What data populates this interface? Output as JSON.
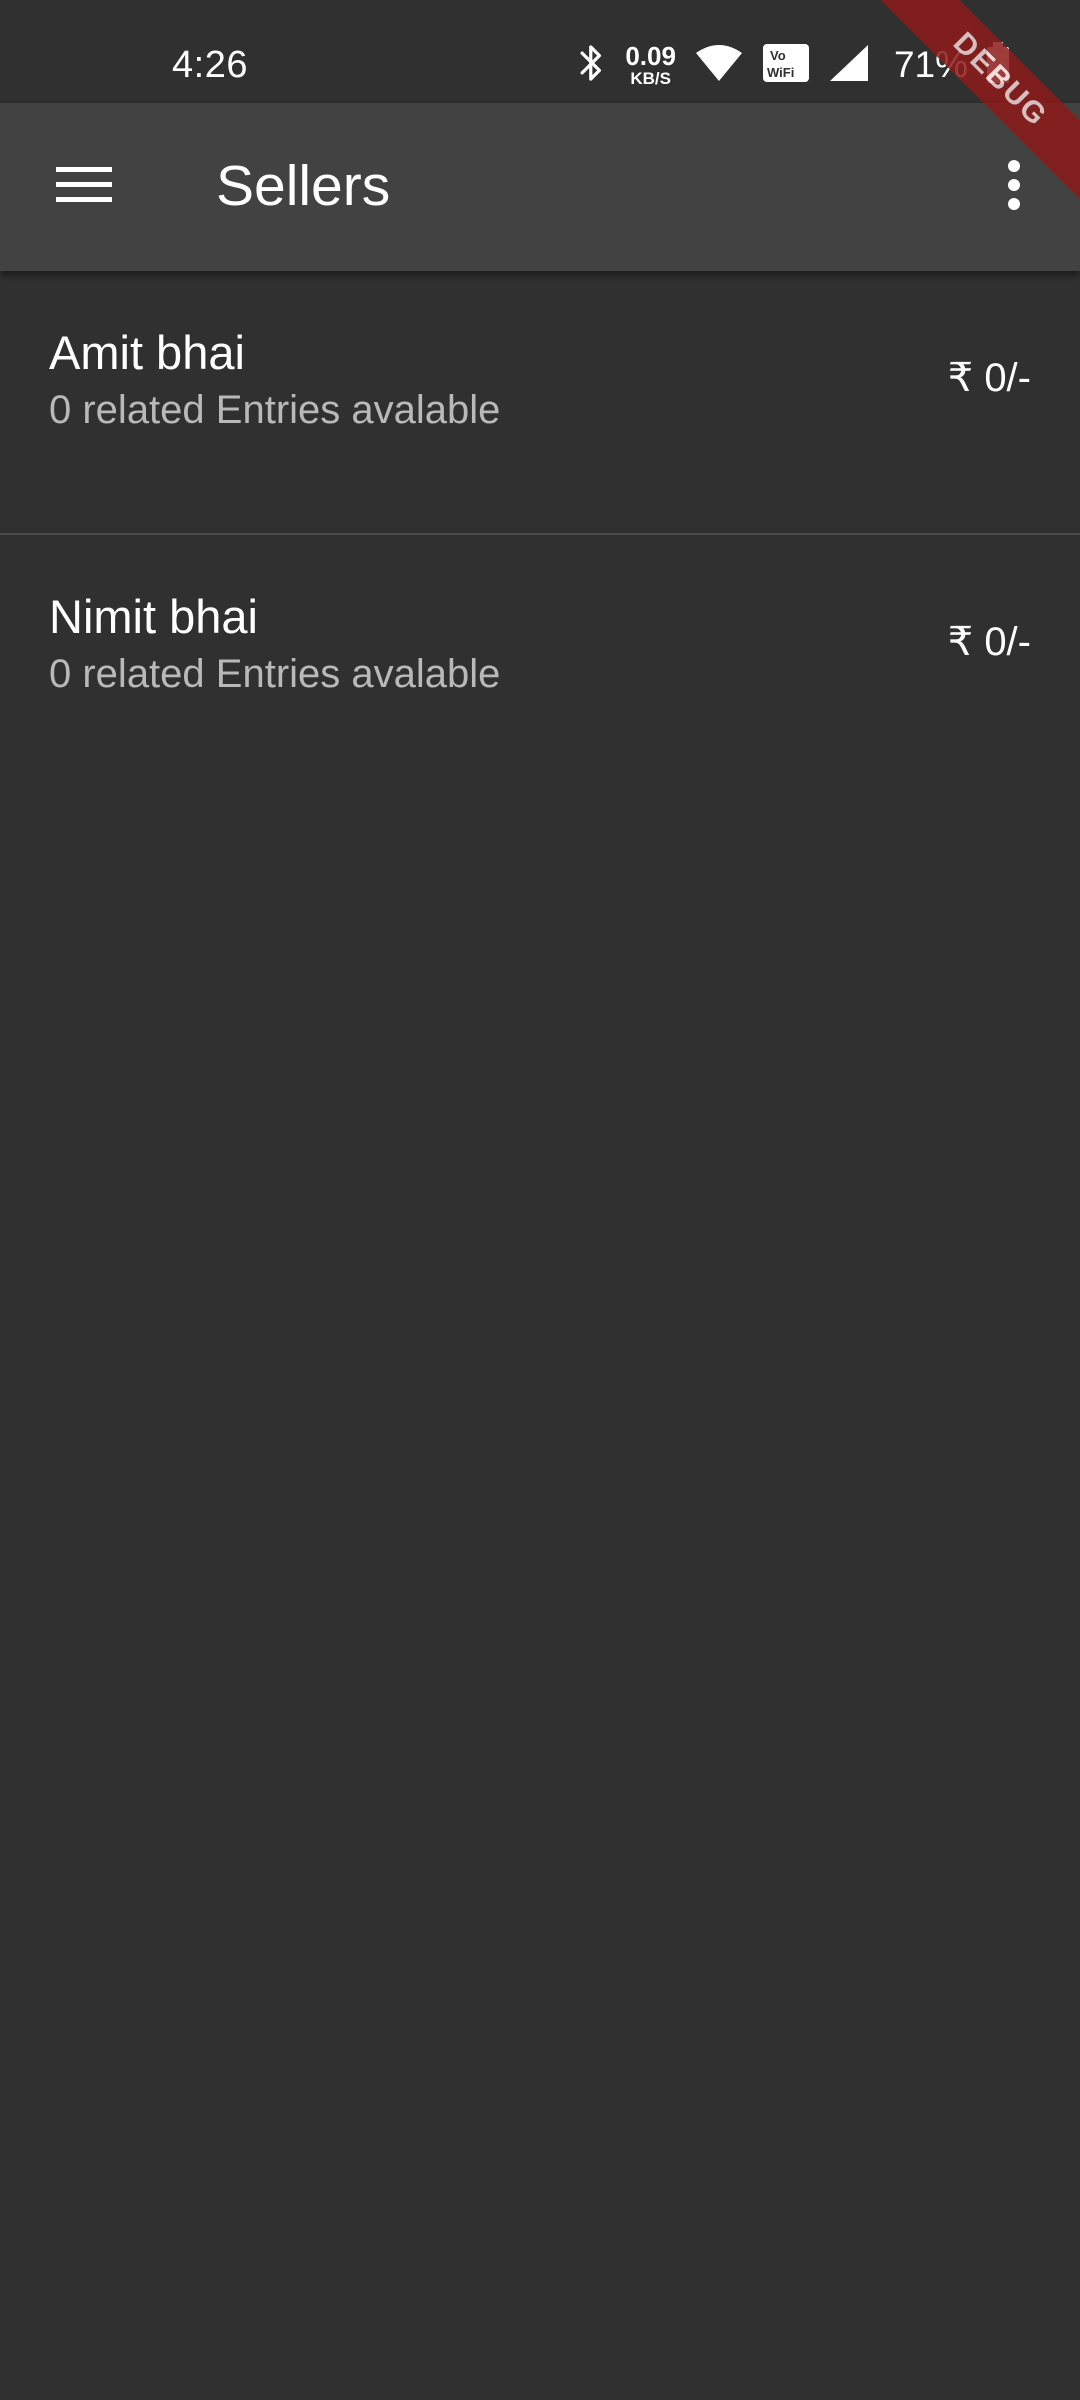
{
  "status_bar": {
    "time": "4:26",
    "net_speed_value": "0.09",
    "net_speed_unit": "KB/S",
    "vowifi_label": "Vo WiFi",
    "battery_percent": "71%"
  },
  "app_bar": {
    "title": "Sellers",
    "menu_icon": "hamburger-menu-icon",
    "more_icon": "more-vert-icon"
  },
  "sellers": [
    {
      "name": "Amit bhai",
      "subtitle": "0 related Entries avalable",
      "amount": "₹ 0/-"
    },
    {
      "name": "Nimit bhai",
      "subtitle": "0 related Entries avalable",
      "amount": "₹ 0/-"
    }
  ],
  "debug_banner": "DEBUG",
  "colors": {
    "background": "#303030",
    "app_bar": "#424242",
    "subtitle": "#b9b9b9",
    "debug_ribbon": "#8e1b1b"
  }
}
